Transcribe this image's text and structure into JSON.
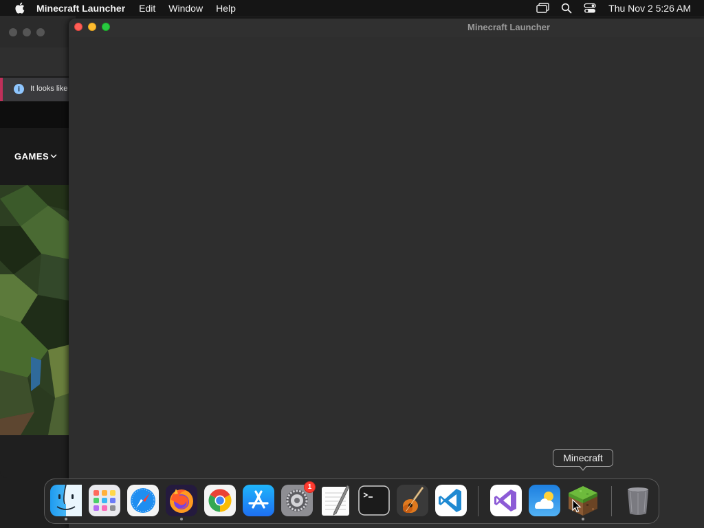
{
  "menubar": {
    "app_name": "Minecraft Launcher",
    "items": [
      "Edit",
      "Window",
      "Help"
    ],
    "status_icons": [
      "screen-mirroring-icon",
      "spotlight-search-icon",
      "control-center-icon"
    ],
    "clock": "Thu Nov 2  5:26 AM"
  },
  "background_window": {
    "infobar_text": "It looks like",
    "games_label": "GAMES",
    "infobar_accent": "#c0305a"
  },
  "main_window": {
    "title": "Minecraft Launcher"
  },
  "dock": {
    "apps": [
      {
        "name": "Finder",
        "icon": "finder-icon",
        "running": true
      },
      {
        "name": "Launchpad",
        "icon": "launchpad-icon",
        "running": false
      },
      {
        "name": "Safari",
        "icon": "safari-icon",
        "running": false
      },
      {
        "name": "Firefox",
        "icon": "firefox-icon",
        "running": true
      },
      {
        "name": "Google Chrome",
        "icon": "chrome-icon",
        "running": false
      },
      {
        "name": "App Store",
        "icon": "app-store-icon",
        "running": false
      },
      {
        "name": "System Settings",
        "icon": "system-settings-icon",
        "running": false,
        "badge": "1"
      },
      {
        "name": "TextEdit",
        "icon": "textedit-icon",
        "running": false
      },
      {
        "name": "Terminal",
        "icon": "terminal-icon",
        "running": false
      },
      {
        "name": "GarageBand",
        "icon": "garageband-icon",
        "running": false
      },
      {
        "name": "Visual Studio Code",
        "icon": "vscode-icon",
        "running": false
      },
      {
        "name": "Visual Studio",
        "icon": "visual-studio-icon",
        "running": false
      },
      {
        "name": "Weather",
        "icon": "weather-icon",
        "running": false
      },
      {
        "name": "Minecraft",
        "icon": "minecraft-icon",
        "running": true
      },
      {
        "name": "Trash",
        "icon": "trash-icon",
        "running": false
      }
    ],
    "tooltip": "Minecraft"
  }
}
